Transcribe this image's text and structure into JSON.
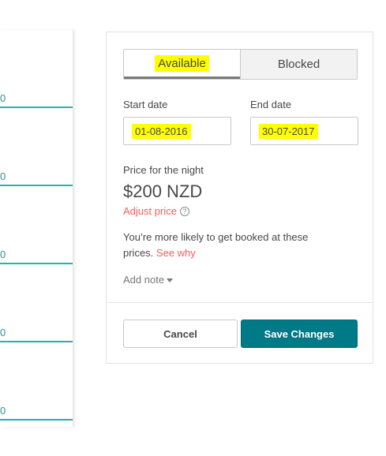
{
  "calendar": {
    "cells": [
      {
        "value": "0"
      },
      {
        "value": "0"
      },
      {
        "value": "0"
      },
      {
        "value": "0"
      },
      {
        "value": "0"
      }
    ],
    "accent_color": "#00a699"
  },
  "panel": {
    "toggle": {
      "available_label": "Available",
      "blocked_label": "Blocked",
      "selected": "Available"
    },
    "start_date": {
      "label": "Start date",
      "value": "01-08-2016"
    },
    "end_date": {
      "label": "End date",
      "value": "30-07-2017"
    },
    "price": {
      "label": "Price for the night",
      "value": "$200 NZD",
      "adjust_label": "Adjust price",
      "help_icon": "question-circle-icon"
    },
    "booking_note": {
      "text": "You’re more likely to get booked at these prices.",
      "link": "See why"
    },
    "add_note": {
      "label": "Add note",
      "icon": "caret-down-icon"
    },
    "buttons": {
      "cancel": "Cancel",
      "save": "Save Changes"
    },
    "colors": {
      "primary": "#007a87",
      "link": "#ff5a5f",
      "highlight": "#ffff00"
    }
  }
}
